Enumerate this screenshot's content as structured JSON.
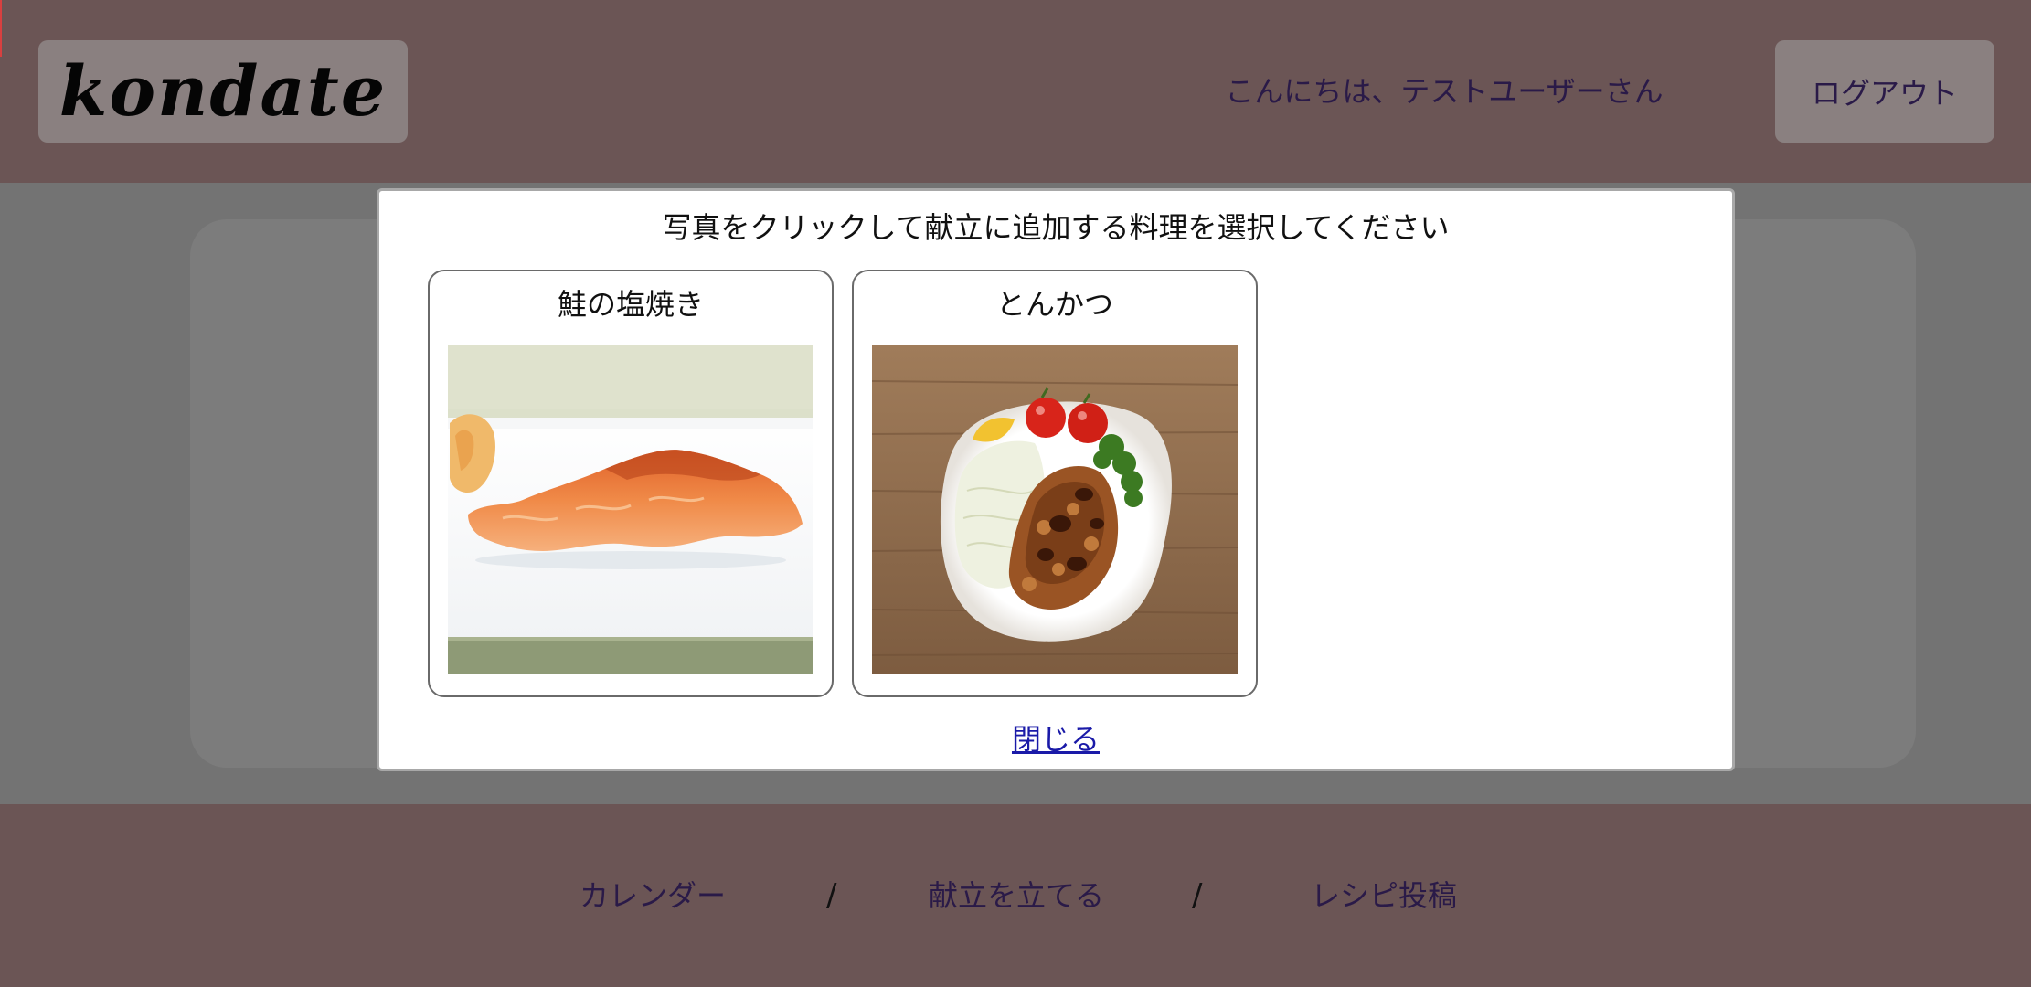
{
  "header": {
    "logo_text": "kondate",
    "greeting": "こんにちは、テストユーザーさん",
    "logout_label": "ログアウト"
  },
  "modal": {
    "title": "写真をクリックして献立に追加する料理を選択してください",
    "dishes": [
      {
        "name": "鮭の塩焼き"
      },
      {
        "name": "とんかつ"
      }
    ],
    "close_label": "閉じる"
  },
  "footer": {
    "nav": [
      {
        "label": "カレンダー"
      },
      {
        "label": "献立を立てる"
      },
      {
        "label": "レシピ投稿"
      }
    ],
    "separator": "/"
  },
  "colors": {
    "header_bg": "#6b5555",
    "overlay_gray": "#737373",
    "text_purple": "#2a1a48",
    "link_blue": "#1a1aa8"
  }
}
